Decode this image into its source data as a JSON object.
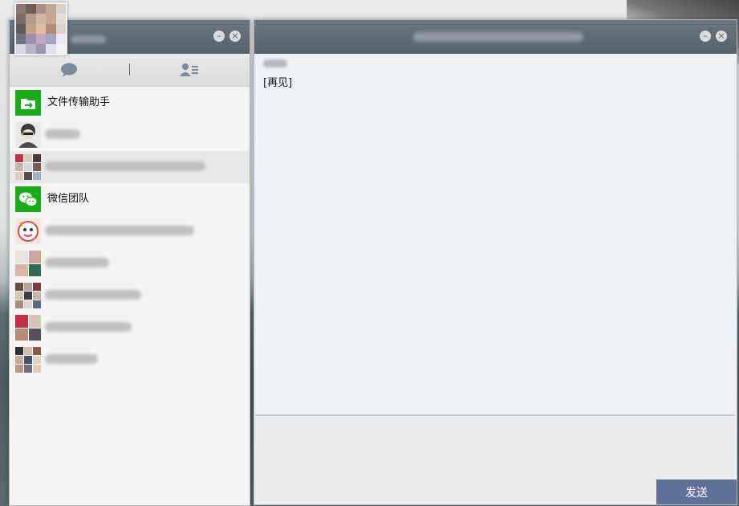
{
  "window_controls": {
    "minimize_glyph": "–",
    "close_glyph": "×"
  },
  "tabs": [
    {
      "icon": "chat-bubble-icon",
      "selected": true
    },
    {
      "icon": "contacts-icon",
      "selected": false
    }
  ],
  "chats": [
    {
      "name": "文件传输助手",
      "avatar_icon": "file-transfer-icon",
      "blurred": false
    },
    {
      "name": "",
      "avatar_icon": "avatar-photo",
      "blurred": true
    },
    {
      "name": "",
      "avatar_icon": "group-avatar",
      "blurred": true,
      "active": true
    },
    {
      "name": "微信团队",
      "avatar_icon": "wechat-team-icon",
      "blurred": false
    },
    {
      "name": "",
      "avatar_icon": "avatar-photo",
      "blurred": true
    },
    {
      "name": "",
      "avatar_icon": "group-avatar",
      "blurred": true
    },
    {
      "name": "",
      "avatar_icon": "group-avatar",
      "blurred": true
    },
    {
      "name": "",
      "avatar_icon": "group-avatar",
      "blurred": true
    },
    {
      "name": "",
      "avatar_icon": "group-avatar",
      "blurred": true
    }
  ],
  "conversation": {
    "messages": [
      {
        "sender_blurred": true,
        "text": "[再见]"
      }
    ]
  },
  "composer": {
    "value": "",
    "send_label": "发送"
  },
  "colors": {
    "title_bar": "#5e6a75",
    "brand_green": "#1aad19",
    "send_button": "#5d7199"
  }
}
